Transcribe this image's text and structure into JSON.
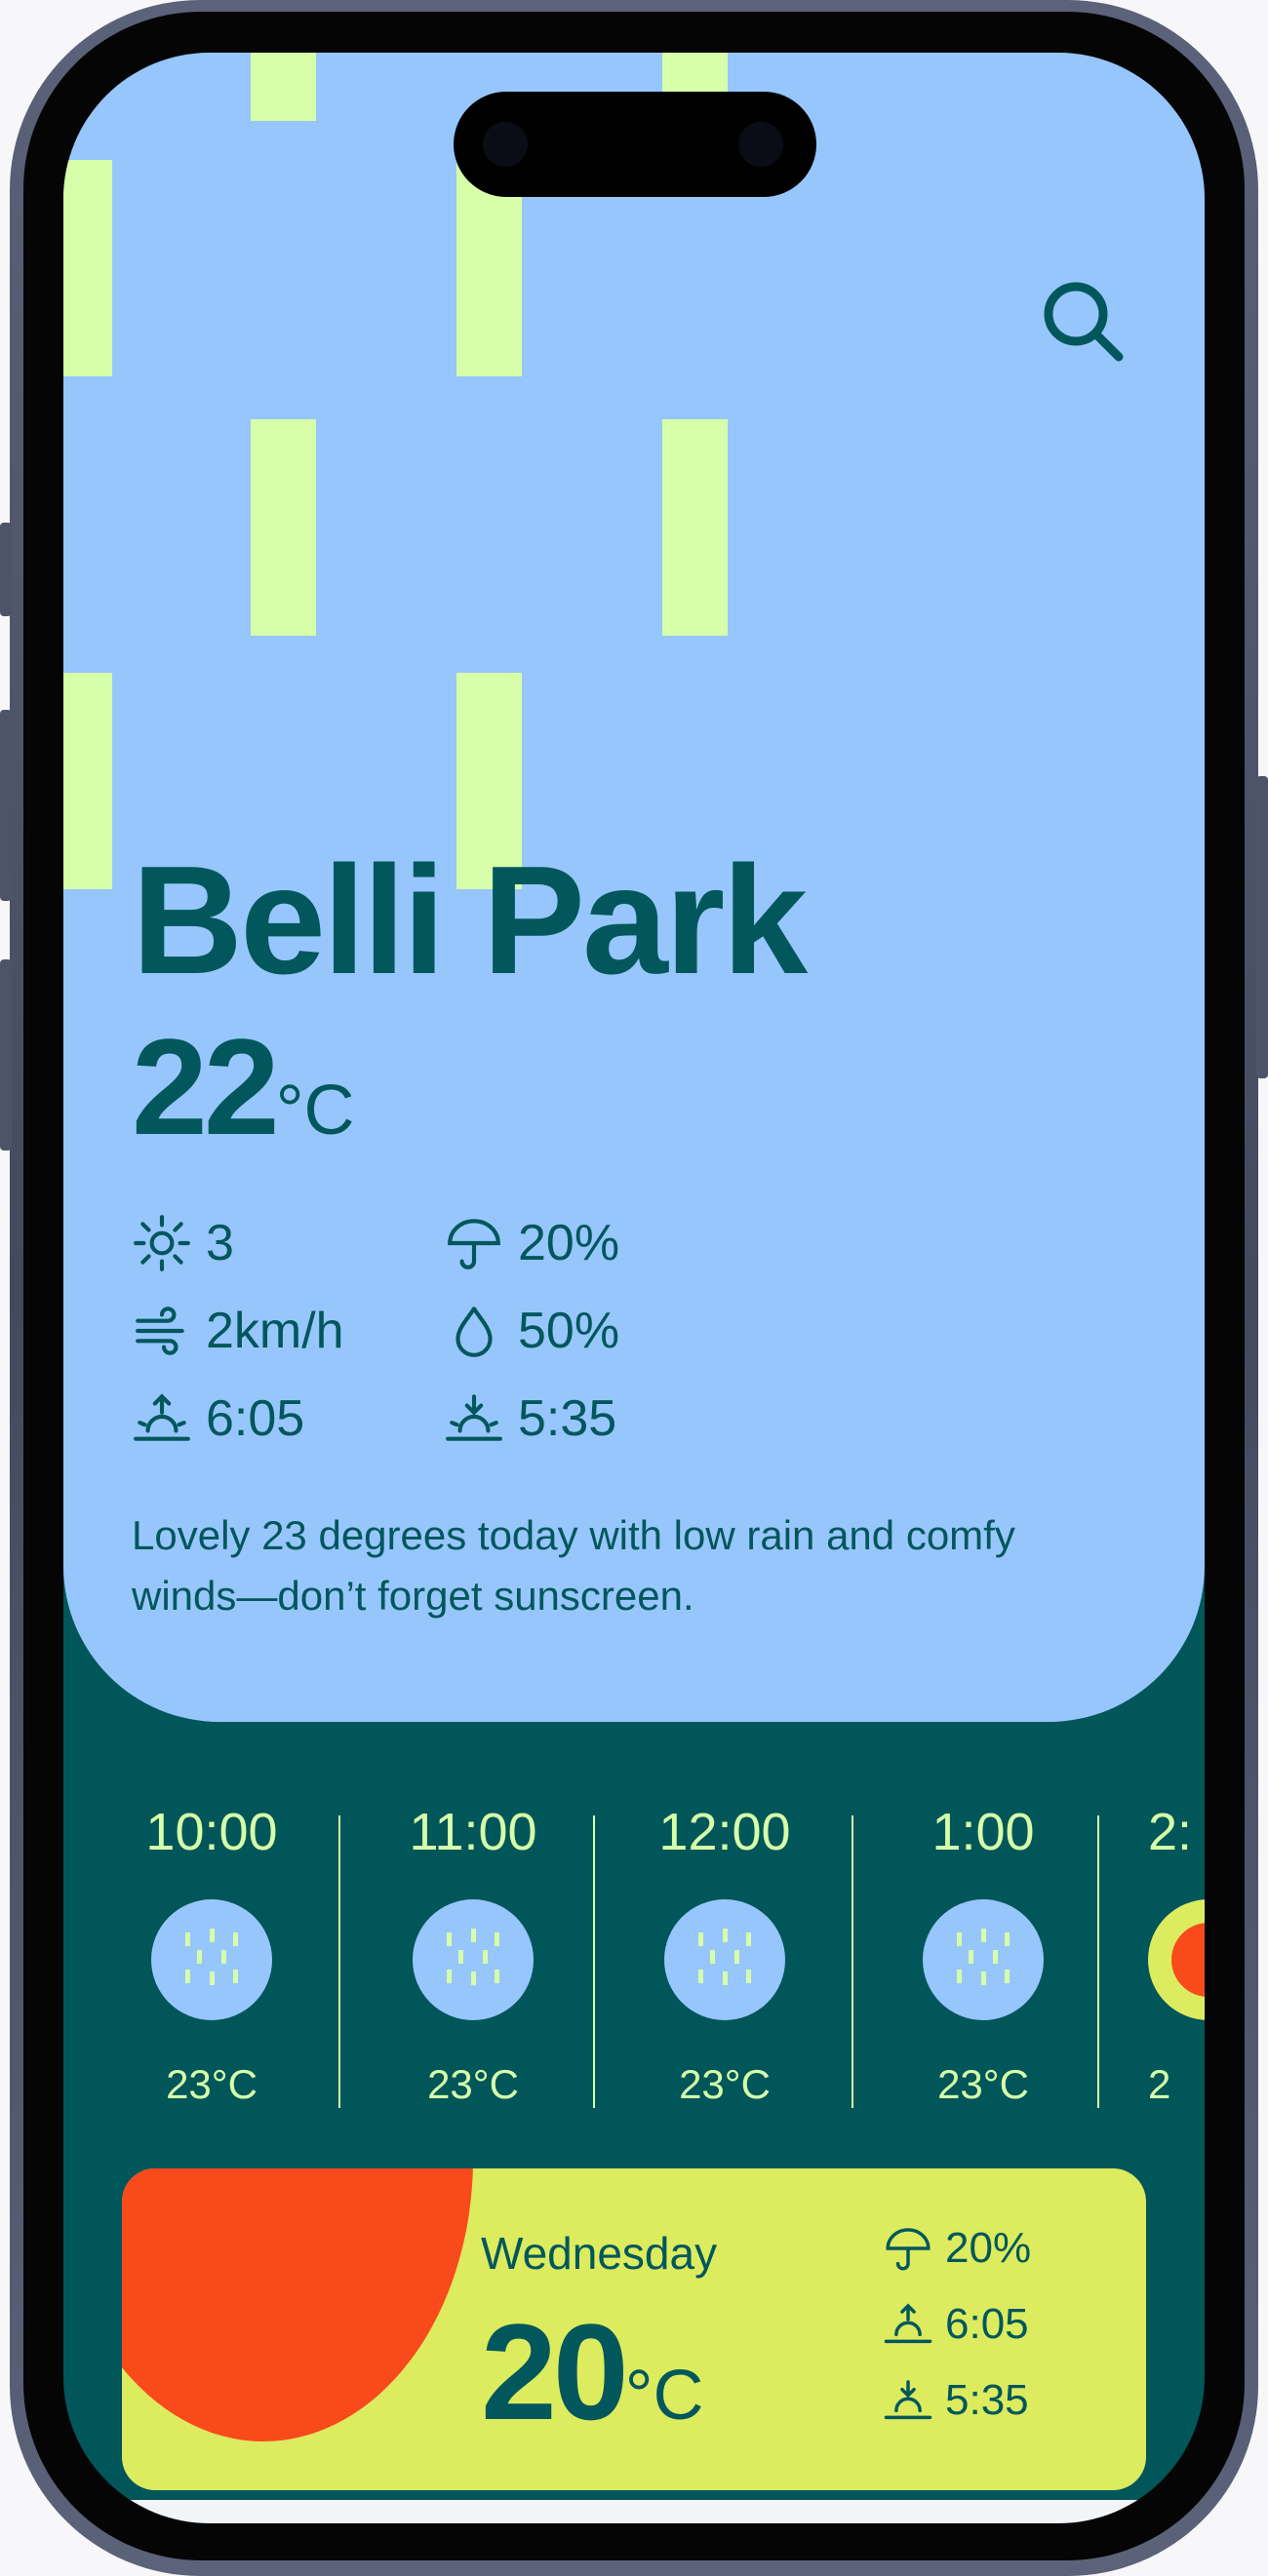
{
  "colors": {
    "hero_bg": "#97c6fc",
    "stripe": "#d7ffa9",
    "dark_teal": "#02575c",
    "card_yellow": "#dcec5e",
    "sun_red": "#f94a1c"
  },
  "header": {
    "search_icon": "search-icon"
  },
  "current": {
    "city": "Belli Park",
    "temp": "22",
    "unit": "°C",
    "stats": {
      "uv": "3",
      "rain": "20%",
      "wind": "2km/h",
      "humidity": "50%",
      "sunrise": "6:05",
      "sunset": "5:35"
    },
    "summary": "Lovely 23 degrees today with low rain and comfy winds—don’t forget sunscreen."
  },
  "hourly": [
    {
      "time": "10:00",
      "temp": "23°C",
      "icon": "rain-icon"
    },
    {
      "time": "11:00",
      "temp": "23°C",
      "icon": "rain-icon"
    },
    {
      "time": "12:00",
      "temp": "23°C",
      "icon": "rain-icon"
    },
    {
      "time": "1:00",
      "temp": "23°C",
      "icon": "rain-icon"
    },
    {
      "time": "2:",
      "temp": "2",
      "icon": "sun-icon"
    }
  ],
  "daily": [
    {
      "day": "Wednesday",
      "temp": "20",
      "unit": "°C",
      "rain": "20%",
      "sunrise": "6:05",
      "sunset": "5:35"
    }
  ]
}
